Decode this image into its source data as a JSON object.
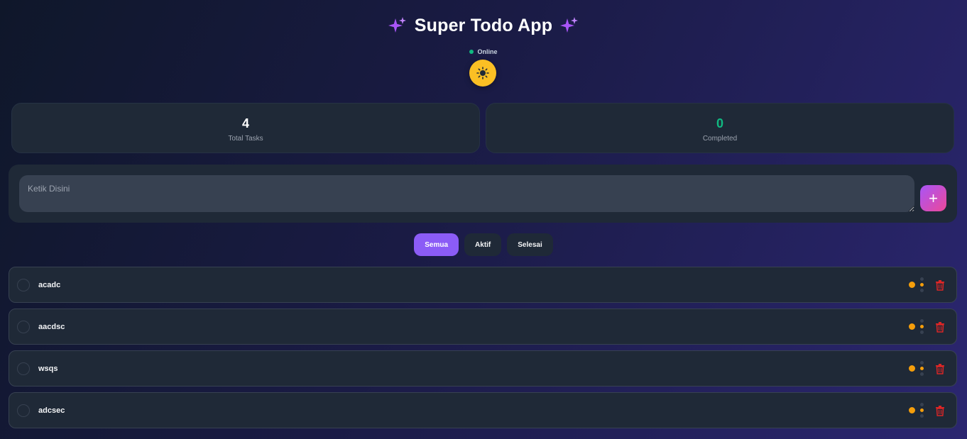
{
  "app": {
    "title": "Super Todo App",
    "status": "Online"
  },
  "theme_toggle": {
    "icon": "sun-icon"
  },
  "stats": {
    "total": {
      "value": "4",
      "label": "Total Tasks",
      "color": "#ffffff"
    },
    "completed": {
      "value": "0",
      "label": "Completed",
      "color": "#10b981"
    }
  },
  "input": {
    "placeholder": "Ketik Disini",
    "value": "",
    "add_label": "+"
  },
  "filters": [
    {
      "label": "Semua",
      "active": true
    },
    {
      "label": "Aktif",
      "active": false
    },
    {
      "label": "Selesai",
      "active": false
    }
  ],
  "tasks": [
    {
      "text": "acadc",
      "completed": false,
      "priority_color": "#f59e0b"
    },
    {
      "text": "aacdsc",
      "completed": false,
      "priority_color": "#f59e0b"
    },
    {
      "text": "wsqs",
      "completed": false,
      "priority_color": "#f59e0b"
    },
    {
      "text": "adcsec",
      "completed": false,
      "priority_color": "#f59e0b"
    }
  ],
  "colors": {
    "accent": "#8b5cf6",
    "success": "#10b981",
    "warning": "#f59e0b",
    "danger": "#ef4444",
    "sun": "#fbbf24"
  }
}
